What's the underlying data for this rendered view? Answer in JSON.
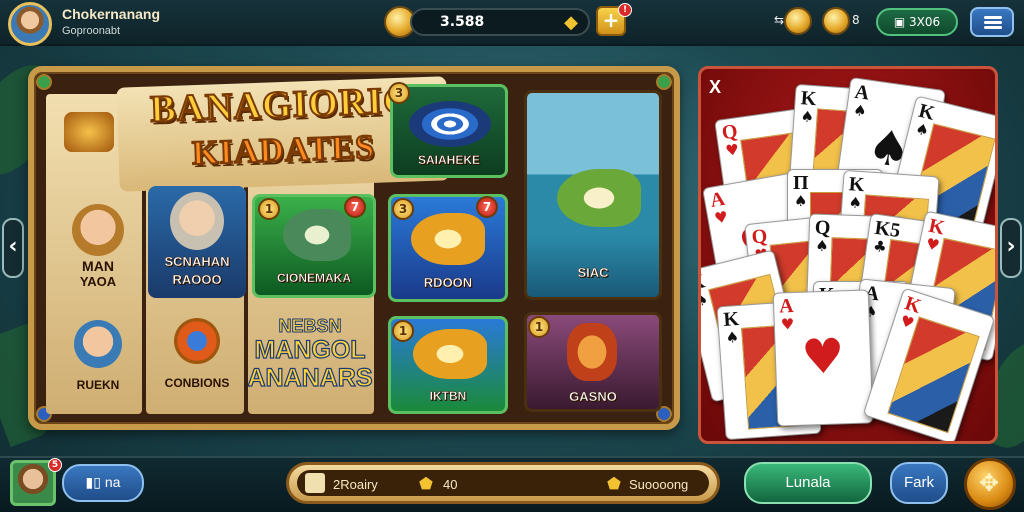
{
  "player": {
    "name": "Chokernanang",
    "subtitle": "Goproonabt"
  },
  "topbar": {
    "balance": "3.588",
    "arrow_icon": "chevron-right-icon",
    "plus_label": "+",
    "plus_badge": "!",
    "coin_count": "8",
    "green_pill": "3X06"
  },
  "main": {
    "title_line1": "BANAGIORIG",
    "title_line2": "KIADATES",
    "mascot_labels": [
      {
        "line1": "MAN",
        "line2": "YAOA"
      },
      {
        "line1": "SCNAHAN",
        "line2": "RAOOO"
      }
    ],
    "bottom_left_labels": [
      "RUEKN",
      "CONBIONS"
    ],
    "promo": {
      "line1": "NEBSN",
      "line2": "MANGOL",
      "line3": "ANANARS"
    },
    "tiles": [
      {
        "label": "SAIAHEKE",
        "badge": "3"
      },
      {
        "label": "SIAC"
      },
      {
        "label": "CIONEMAKA",
        "badge": "1",
        "badge2": "7"
      },
      {
        "label": "RDOON",
        "badge": "3",
        "badge2": "7"
      },
      {
        "label": "IKTBN",
        "badge": "1"
      },
      {
        "label": "GASNO",
        "badge": "1"
      }
    ]
  },
  "cards_panel": {
    "close_label": "X",
    "cards": [
      {
        "rank": "Q",
        "suit": "♥",
        "color": "red"
      },
      {
        "rank": "K",
        "suit": "♠",
        "color": "blk"
      },
      {
        "rank": "A",
        "suit": "♠",
        "color": "blk"
      },
      {
        "rank": "K",
        "suit": "♠",
        "color": "blk"
      },
      {
        "rank": "A",
        "suit": "♥",
        "color": "red"
      },
      {
        "rank": "Π",
        "suit": "♠",
        "color": "blk"
      },
      {
        "rank": "K",
        "suit": "♠",
        "color": "blk"
      },
      {
        "rank": "Q",
        "suit": "♥",
        "color": "red"
      },
      {
        "rank": "Q",
        "suit": "♠",
        "color": "blk"
      },
      {
        "rank": "K5",
        "suit": "♣",
        "color": "blk"
      },
      {
        "rank": "K",
        "suit": "♥",
        "color": "red"
      },
      {
        "rank": "K",
        "suit": "♠",
        "color": "blk"
      },
      {
        "rank": "K",
        "suit": "♠",
        "color": "blk"
      },
      {
        "rank": "A",
        "suit": "♠",
        "color": "blk"
      },
      {
        "rank": "K",
        "suit": "♠",
        "color": "blk"
      },
      {
        "rank": "A",
        "suit": "♥",
        "color": "red"
      },
      {
        "rank": "K",
        "suit": "♥",
        "color": "red"
      }
    ]
  },
  "bottombar": {
    "avatar_badge": "5",
    "book_label": "na",
    "mid_item1": "2Roairy",
    "mid_item2": "40",
    "mid_item3": "Suoooong",
    "green_button": "Lunala",
    "blue_button": "Fark"
  },
  "colors": {
    "gold": "#e8c15a",
    "panel_red": "#b21a1a",
    "frame": "#c79a4a"
  }
}
